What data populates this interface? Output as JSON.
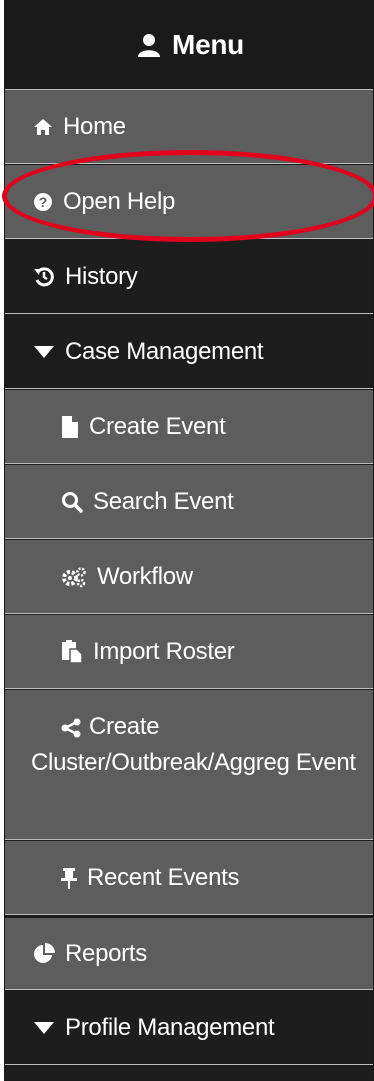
{
  "menu": {
    "title": "Menu",
    "icon": "user-icon"
  },
  "items": [
    {
      "label": "Home",
      "icon": "home-icon"
    },
    {
      "label": "Open Help",
      "icon": "question-circle-icon"
    },
    {
      "label": "History",
      "icon": "history-icon"
    },
    {
      "label": "Case Management",
      "icon": "caret-down-icon"
    },
    {
      "label": "Create Event",
      "icon": "file-icon"
    },
    {
      "label": "Search Event",
      "icon": "search-icon"
    },
    {
      "label": "Workflow",
      "icon": "cogs-icon"
    },
    {
      "label": "Import Roster",
      "icon": "paste-icon"
    },
    {
      "label_line1": "Create",
      "label_rest": "Cluster/Outbreak/Aggreg Event",
      "icon": "share-icon"
    },
    {
      "label": "Recent Events",
      "icon": "pushpin-icon"
    },
    {
      "label": "Reports",
      "icon": "pie-chart-icon"
    },
    {
      "label": "Profile Management",
      "icon": "caret-down-icon"
    }
  ],
  "colors": {
    "dark": "#1d1d1d",
    "gray": "#5d5d5d",
    "highlight": "#e3001b"
  }
}
